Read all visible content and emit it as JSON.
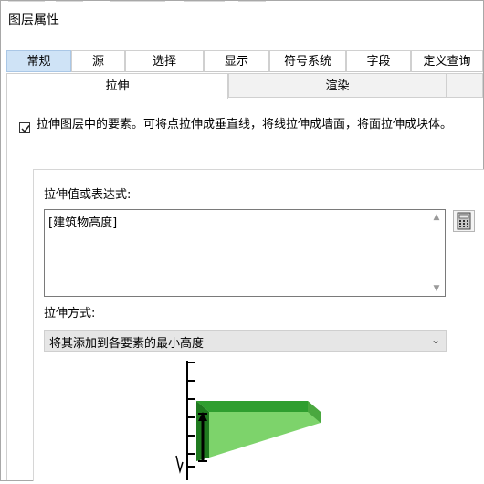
{
  "window": {
    "title": "图层属性"
  },
  "tabs_row1": [
    {
      "label": "常规"
    },
    {
      "label": "源"
    },
    {
      "label": "选择"
    },
    {
      "label": "显示"
    },
    {
      "label": "符号系统"
    },
    {
      "label": "字段"
    },
    {
      "label": "定义查询"
    }
  ],
  "tabs_row2": [
    {
      "label": "拉伸",
      "active": true
    },
    {
      "label": "渲染",
      "active": false
    }
  ],
  "extrude": {
    "checkbox_label": "拉伸图层中的要素。可将点拉伸成垂直线，将线拉伸成墙面，将面拉伸成块体。",
    "checked": true,
    "value_label": "拉伸值或表达式:",
    "value_text": "[建筑物高度]",
    "method_label": "拉伸方式:",
    "method_selected": "将其添加到各要素的最小高度"
  },
  "colors": {
    "active_tab": "#cfe3f6",
    "illustration_green": "#7dd36b"
  },
  "icons": [
    "check-icon",
    "calculator-icon",
    "chevron-down-icon",
    "scroll-up-icon",
    "scroll-down-icon"
  ]
}
